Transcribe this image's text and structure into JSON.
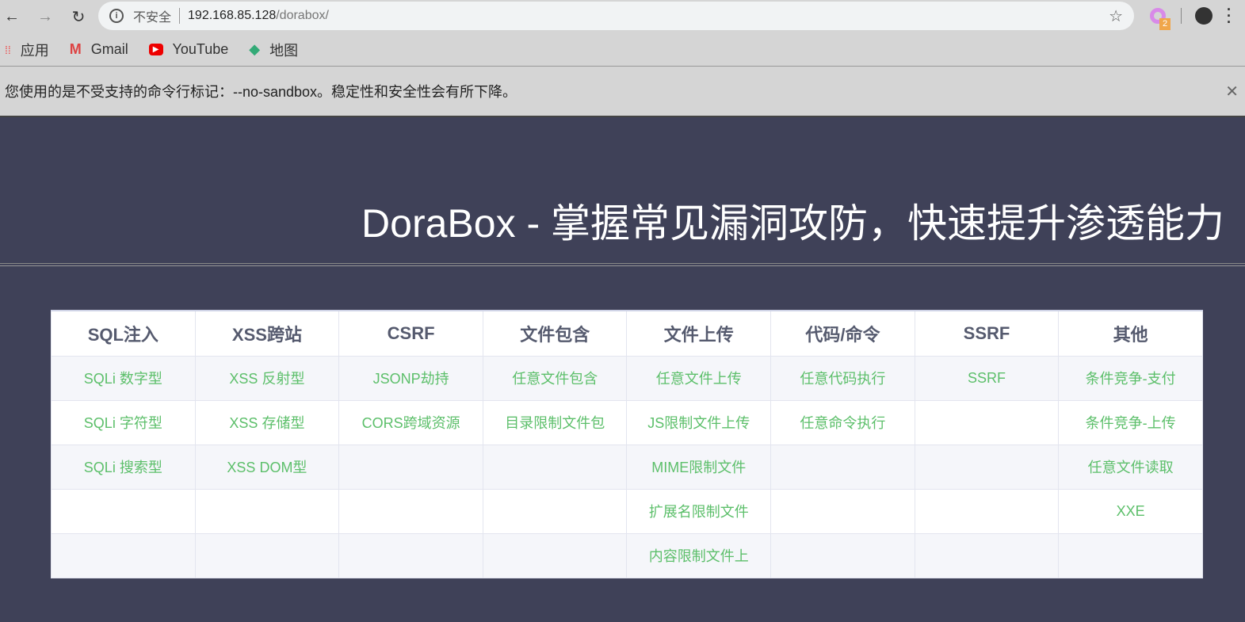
{
  "browser": {
    "insecure_label": "不安全",
    "url_host": "192.168.85.128",
    "url_path": "/dorabox/",
    "ext_badge": "2",
    "bookmarks": [
      {
        "label": "应用",
        "icon": "apps-icon"
      },
      {
        "label": "Gmail",
        "icon": "gmail-icon"
      },
      {
        "label": "YouTube",
        "icon": "youtube-icon"
      },
      {
        "label": "地图",
        "icon": "maps-icon"
      }
    ],
    "warning": "您使用的是不受支持的命令行标记：--no-sandbox。稳定性和安全性会有所下降。"
  },
  "page": {
    "title": "DoraBox - 掌握常见漏洞攻防，快速提升渗透能力",
    "headers": [
      "SQL注入",
      "XSS跨站",
      "CSRF",
      "文件包含",
      "文件上传",
      "代码/命令",
      "SSRF",
      "其他"
    ],
    "rows": [
      [
        "SQLi 数字型",
        "XSS 反射型",
        "JSONP劫持",
        "任意文件包含",
        "任意文件上传",
        "任意代码执行",
        "SSRF",
        "条件竞争-支付"
      ],
      [
        "SQLi 字符型",
        "XSS 存储型",
        "CORS跨域资源",
        "目录限制文件包",
        "JS限制文件上传",
        "任意命令执行",
        "",
        "条件竞争-上传"
      ],
      [
        "SQLi 搜索型",
        "XSS DOM型",
        "",
        "",
        "MIME限制文件",
        "",
        "",
        "任意文件读取"
      ],
      [
        "",
        "",
        "",
        "",
        "扩展名限制文件",
        "",
        "",
        "XXE"
      ],
      [
        "",
        "",
        "",
        "",
        "内容限制文件上",
        "",
        "",
        ""
      ]
    ]
  }
}
